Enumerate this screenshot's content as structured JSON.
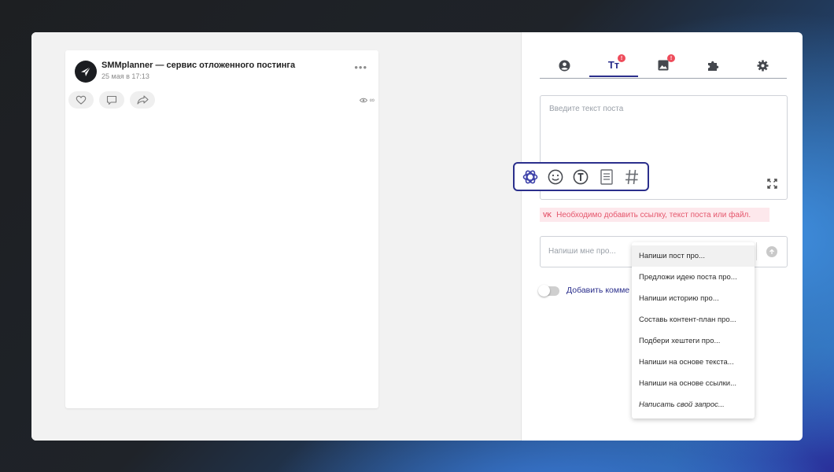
{
  "post": {
    "name": "SMMplanner — сервис отложенного постинга",
    "date": "25 мая в 17:13",
    "views": "∞",
    "more": "•••"
  },
  "tabs": [
    {
      "icon": "user-icon",
      "badge": ""
    },
    {
      "icon": "text-icon",
      "label": "Tт",
      "badge": "!"
    },
    {
      "icon": "image-icon",
      "badge": "!"
    },
    {
      "icon": "puzzle-icon",
      "badge": ""
    },
    {
      "icon": "gear-icon",
      "badge": ""
    }
  ],
  "editor": {
    "placeholder": "Введите текст поста"
  },
  "toolbar": {
    "tools": [
      "chatgpt-icon",
      "emoji-icon",
      "text-format-icon",
      "template-icon",
      "hashtag-icon"
    ]
  },
  "error": {
    "network": "VK",
    "message": "Необходимо добавить ссылку, текст поста или файл."
  },
  "ai_input": {
    "placeholder": "Напиши мне про..."
  },
  "comment_toggle": {
    "label": "Добавить комме",
    "enabled": false
  },
  "dropdown": {
    "items": [
      "Напиши пост про...",
      "Предложи идею поста про...",
      "Напиши историю про...",
      "Составь контент-план про...",
      "Подбери хештеги про...",
      "Напиши на основе текста...",
      "Напиши на основе ссылки...",
      "Написать свой запрос..."
    ]
  },
  "colors": {
    "accent": "#2b2f8c",
    "error": "#e5566c",
    "badge": "#ee4c5b"
  }
}
